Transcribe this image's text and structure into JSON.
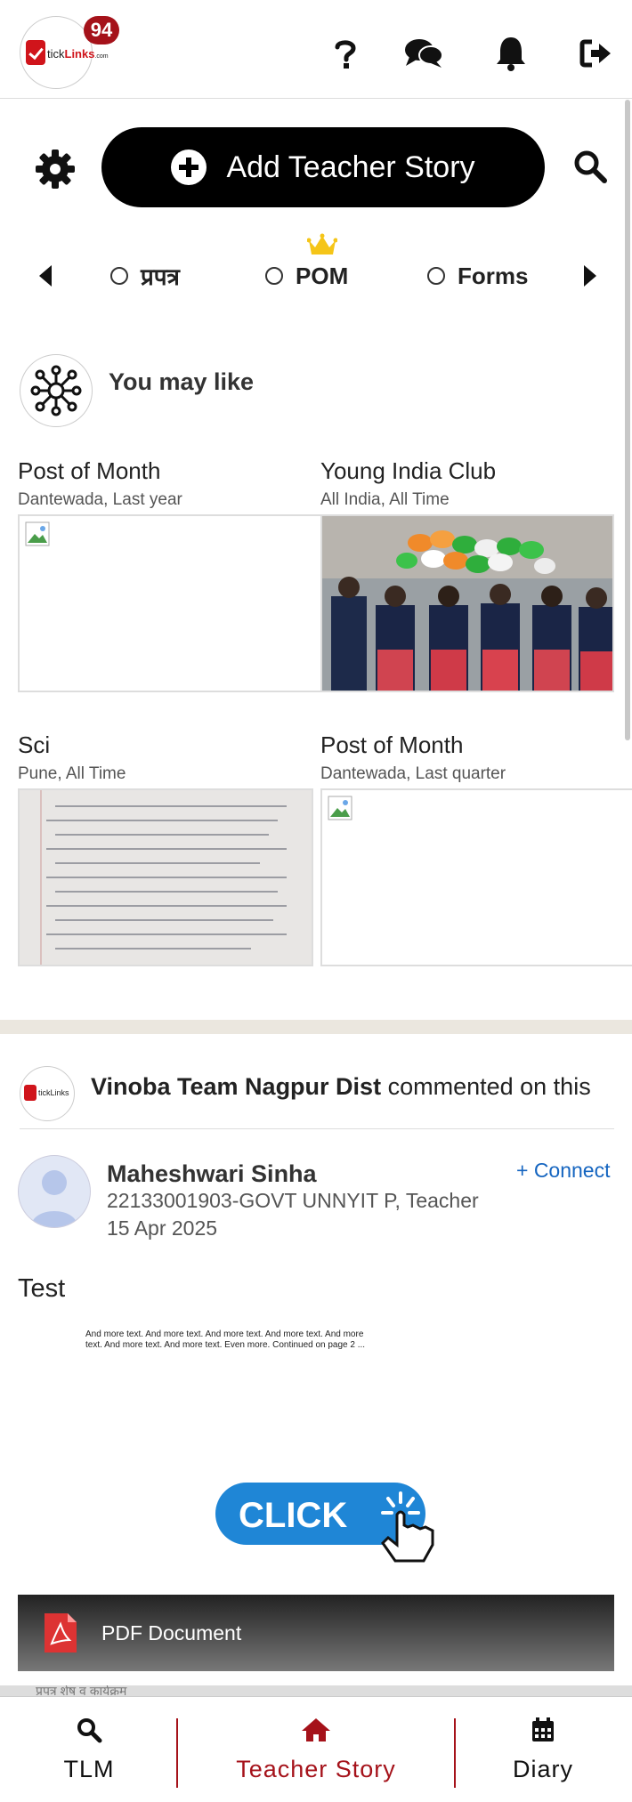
{
  "header": {
    "logo_text_prefix": "tick",
    "logo_text_main": "Links",
    "logo_text_suffix": ".com",
    "notification_count": "94",
    "icons": [
      "help-icon",
      "chat-icon",
      "bell-icon",
      "logout-icon"
    ]
  },
  "actions": {
    "add_story_label": "Add Teacher Story"
  },
  "filters": {
    "options": [
      {
        "label": "प्रपत्र"
      },
      {
        "label": "POM"
      },
      {
        "label": "Forms"
      }
    ]
  },
  "you_may_like": {
    "title": "You may like",
    "cards": [
      {
        "title": "Post of Month",
        "subtitle": "Dantewada, Last year",
        "image": "broken"
      },
      {
        "title": "Young India Club",
        "subtitle": "All India, All Time",
        "image": "photo-group-balloons"
      },
      {
        "title": "Sci",
        "subtitle": "Pune, All Time",
        "image": "photo-handwritten-page"
      },
      {
        "title": "Post of Month",
        "subtitle": "Dantewada, Last quarter",
        "image": "broken"
      }
    ]
  },
  "feed": {
    "commenter": "Vinoba Team Nagpur Dist",
    "comment_suffix": "commented on this",
    "author_name": "Maheshwari Sinha",
    "author_meta": "22133001903-GOVT UNNYIT P, Teacher",
    "post_date": "15 Apr 2025",
    "connect_label": "+ Connect",
    "post_text": "Test",
    "doc_preview_line1": "And more text. And more text. And more text. And more text. And more",
    "doc_preview_line2": "text. And more text. And more text. Even more. Continued on page 2 ...",
    "click_label": "CLICK",
    "pdf_label": "PDF Document",
    "pdf_strip_text": "प्रपत्र शेष व कार्यक्रम"
  },
  "bottom_nav": {
    "items": [
      {
        "label": "TLM",
        "icon": "search-icon"
      },
      {
        "label": "Teacher Story",
        "icon": "home-icon"
      },
      {
        "label": "Diary",
        "icon": "calendar-icon"
      }
    ],
    "active_color": "#a5121a"
  },
  "colors": {
    "brand_red": "#d0141b",
    "badge": "#a5121a",
    "link_blue": "#1565c0"
  }
}
